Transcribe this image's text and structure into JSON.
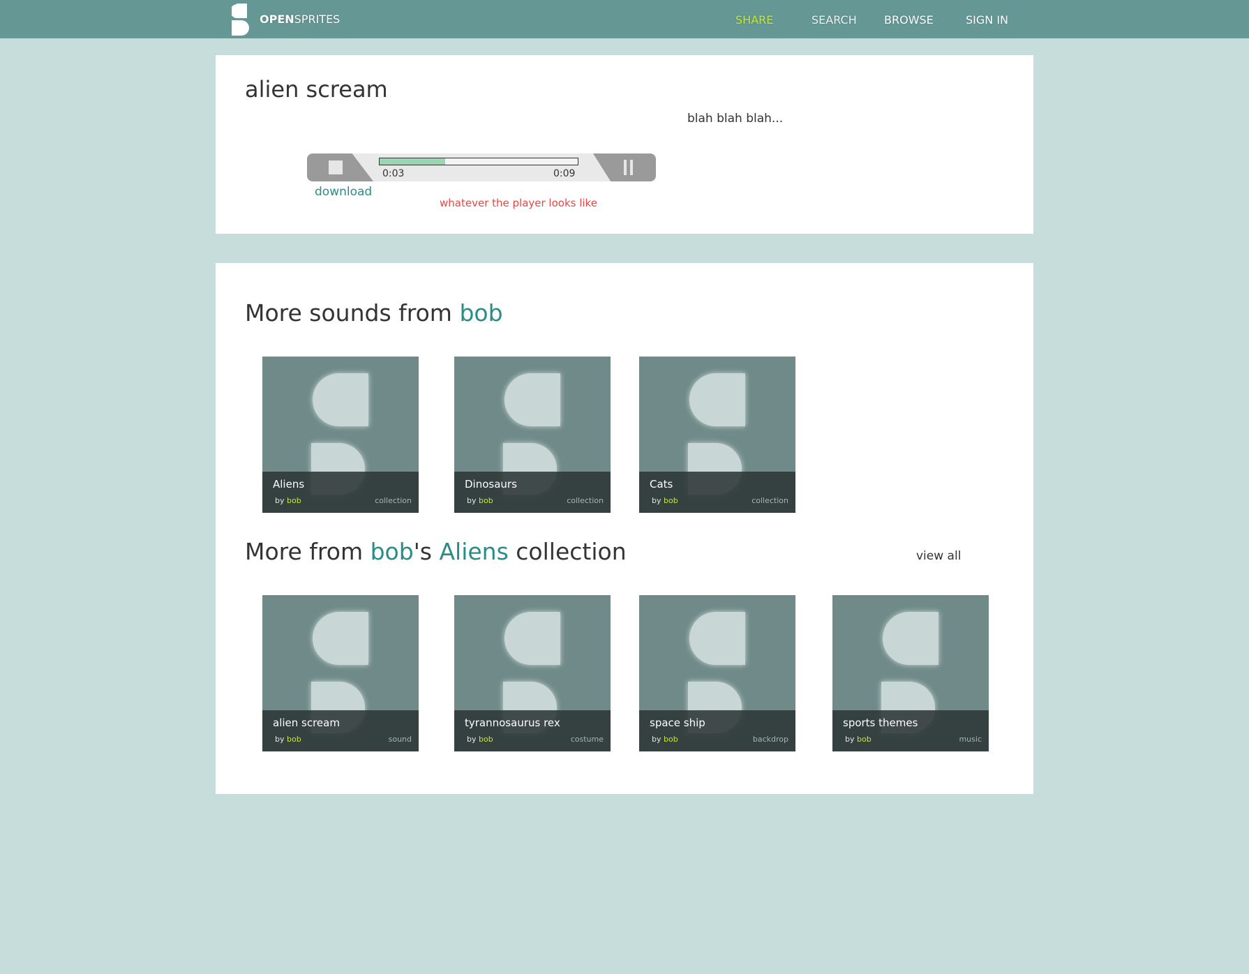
{
  "header": {
    "brand_bold": "OPEN",
    "brand_light": "SPRITES",
    "nav": {
      "share": "SHARE",
      "search": "SEARCH",
      "browse": "BROWSE",
      "signin": "SIGN IN"
    },
    "colors": {
      "bar": "#659794",
      "accent": "#c4e832"
    }
  },
  "sound": {
    "title": "alien scream",
    "description": "blah blah blah...",
    "player": {
      "current_time": "0:03",
      "total_time": "0:09",
      "progress_fraction": 0.33,
      "stop_icon": "stop-icon",
      "pause_icon": "pause-icon"
    },
    "download_label": "download",
    "player_note": "whatever the player looks like"
  },
  "more_from_user": {
    "heading_prefix": "More sounds from",
    "user": "bob",
    "items": [
      {
        "name": "Aliens",
        "by": "by",
        "author": "bob",
        "kind": "collection"
      },
      {
        "name": "Dinosaurs",
        "by": "by",
        "author": "bob",
        "kind": "collection"
      },
      {
        "name": "Cats",
        "by": "by",
        "author": "bob",
        "kind": "collection"
      }
    ]
  },
  "collection": {
    "heading_prefix": "More from",
    "user": "bob",
    "possessive": "'s",
    "collection_name": "Aliens",
    "heading_suffix": "collection",
    "view_all": "view all",
    "items": [
      {
        "name": "alien scream",
        "by": "by",
        "author": "bob",
        "kind": "sound"
      },
      {
        "name": "tyrannosaurus rex",
        "by": "by",
        "author": "bob",
        "kind": "costume"
      },
      {
        "name": "space ship",
        "by": "by",
        "author": "bob",
        "kind": "backdrop"
      },
      {
        "name": "sports themes",
        "by": "by",
        "author": "bob",
        "kind": "music"
      }
    ]
  }
}
